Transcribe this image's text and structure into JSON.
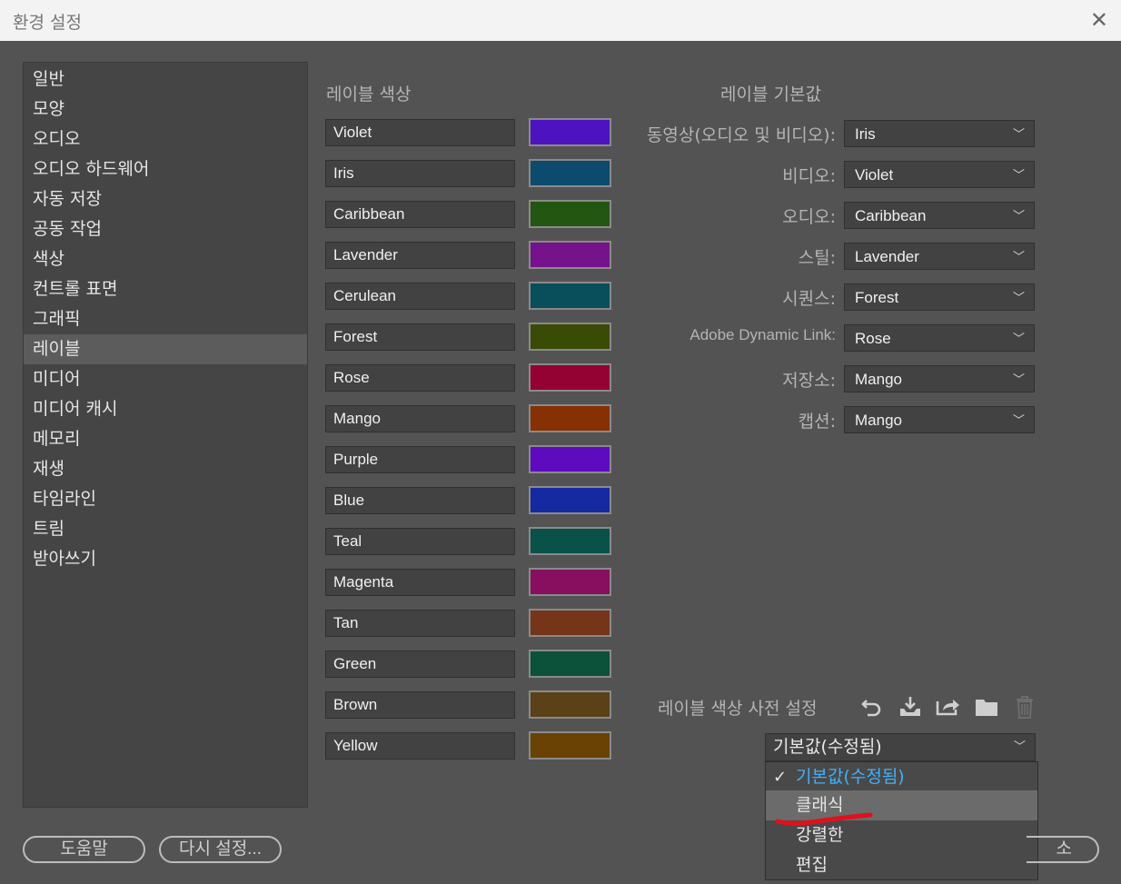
{
  "window": {
    "title": "환경 설정",
    "close_glyph": "✕"
  },
  "sidebar": {
    "items": [
      "일반",
      "모양",
      "오디오",
      "오디오 하드웨어",
      "자동 저장",
      "공동 작업",
      "색상",
      "컨트롤 표면",
      "그래픽",
      "레이블",
      "미디어",
      "미디어 캐시",
      "메모리",
      "재생",
      "타임라인",
      "트림",
      "받아쓰기"
    ],
    "selected": "레이블"
  },
  "label_colors": {
    "title": "레이블 색상",
    "items": [
      {
        "name": "Violet",
        "color": "#4d13c1"
      },
      {
        "name": "Iris",
        "color": "#0c4b6e"
      },
      {
        "name": "Caribbean",
        "color": "#235611"
      },
      {
        "name": "Lavender",
        "color": "#76138c"
      },
      {
        "name": "Cerulean",
        "color": "#094e5b"
      },
      {
        "name": "Forest",
        "color": "#3a4b06"
      },
      {
        "name": "Rose",
        "color": "#930232"
      },
      {
        "name": "Mango",
        "color": "#863003"
      },
      {
        "name": "Purple",
        "color": "#5e0bc0"
      },
      {
        "name": "Blue",
        "color": "#152aa0"
      },
      {
        "name": "Teal",
        "color": "#08524a"
      },
      {
        "name": "Magenta",
        "color": "#880f5f"
      },
      {
        "name": "Tan",
        "color": "#763419"
      },
      {
        "name": "Green",
        "color": "#0c513a"
      },
      {
        "name": "Brown",
        "color": "#5b4117"
      },
      {
        "name": "Yellow",
        "color": "#6a4203"
      }
    ]
  },
  "label_defaults": {
    "title": "레이블 기본값",
    "rows": [
      {
        "label": "동영상(오디오 및 비디오):",
        "value": "Iris"
      },
      {
        "label": "비디오:",
        "value": "Violet"
      },
      {
        "label": "오디오:",
        "value": "Caribbean"
      },
      {
        "label": "스틸:",
        "value": "Lavender"
      },
      {
        "label": "시퀀스:",
        "value": "Forest"
      },
      {
        "label": "Adobe Dynamic Link:",
        "value": "Rose"
      },
      {
        "label": "저장소:",
        "value": "Mango"
      },
      {
        "label": "캡션:",
        "value": "Mango"
      }
    ]
  },
  "preset": {
    "label": "레이블 색상 사전 설정",
    "tools": [
      "undo-icon",
      "import-icon",
      "export-icon",
      "folder-icon",
      "trash-icon"
    ],
    "selected": "기본값(수정됨)",
    "options": [
      "기본값(수정됨)",
      "클래식",
      "강렬한",
      "편집"
    ],
    "hovered": "클래식"
  },
  "buttons": {
    "help": "도움말",
    "reset": "다시 설정...",
    "cancel_partial": "소"
  },
  "colors": {
    "accent": "#42b0f5",
    "annotation": "#e0101c"
  }
}
